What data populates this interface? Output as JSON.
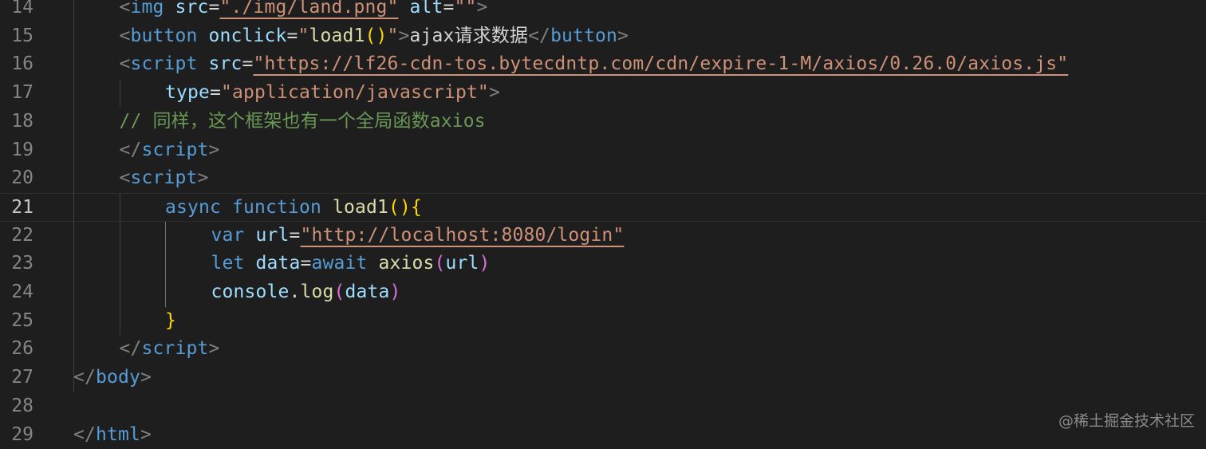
{
  "editor": {
    "lines": [
      {
        "number": "14",
        "indent": 2,
        "tokens": [
          {
            "t": "<",
            "c": "punc"
          },
          {
            "t": "img",
            "c": "tag"
          },
          {
            "t": " ",
            "c": "text"
          },
          {
            "t": "src",
            "c": "attr"
          },
          {
            "t": "=",
            "c": "text"
          },
          {
            "t": "\"./img/land.png\"",
            "c": "str"
          },
          {
            "t": " ",
            "c": "text"
          },
          {
            "t": "alt",
            "c": "attr"
          },
          {
            "t": "=",
            "c": "text"
          },
          {
            "t": "\"\"",
            "c": "str-plain"
          },
          {
            "t": ">",
            "c": "punc"
          }
        ]
      },
      {
        "number": "15",
        "indent": 2,
        "tokens": [
          {
            "t": "<",
            "c": "punc"
          },
          {
            "t": "button",
            "c": "tag"
          },
          {
            "t": " ",
            "c": "text"
          },
          {
            "t": "onclick",
            "c": "attr"
          },
          {
            "t": "=",
            "c": "text"
          },
          {
            "t": "\"",
            "c": "str-plain"
          },
          {
            "t": "load1",
            "c": "fn"
          },
          {
            "t": "()",
            "c": "brace1"
          },
          {
            "t": "\"",
            "c": "str-plain"
          },
          {
            "t": ">",
            "c": "punc"
          },
          {
            "t": "ajax请求数据",
            "c": "text"
          },
          {
            "t": "</",
            "c": "punc"
          },
          {
            "t": "button",
            "c": "tag"
          },
          {
            "t": ">",
            "c": "punc"
          }
        ]
      },
      {
        "number": "16",
        "indent": 2,
        "tokens": [
          {
            "t": "<",
            "c": "punc"
          },
          {
            "t": "script",
            "c": "tag"
          },
          {
            "t": " ",
            "c": "text"
          },
          {
            "t": "src",
            "c": "attr"
          },
          {
            "t": "=",
            "c": "text"
          },
          {
            "t": "\"https://lf26-cdn-tos.bytecdntp.com/cdn/expire-1-M/axios/0.26.0/axios.js\"",
            "c": "str"
          }
        ]
      },
      {
        "number": "17",
        "indent": 3,
        "tokens": [
          {
            "t": "type",
            "c": "attr"
          },
          {
            "t": "=",
            "c": "text"
          },
          {
            "t": "\"application/javascript\"",
            "c": "str-plain"
          },
          {
            "t": ">",
            "c": "punc"
          }
        ]
      },
      {
        "number": "18",
        "indent": 2,
        "tokens": [
          {
            "t": "// 同样，这个框架也有一个全局函数axios",
            "c": "comment"
          }
        ]
      },
      {
        "number": "19",
        "indent": 2,
        "tokens": [
          {
            "t": "</",
            "c": "punc"
          },
          {
            "t": "script",
            "c": "tag"
          },
          {
            "t": ">",
            "c": "punc"
          }
        ]
      },
      {
        "number": "20",
        "indent": 2,
        "tokens": [
          {
            "t": "<",
            "c": "punc"
          },
          {
            "t": "script",
            "c": "tag"
          },
          {
            "t": ">",
            "c": "punc"
          }
        ]
      },
      {
        "number": "21",
        "indent": 3,
        "current": true,
        "tokens": [
          {
            "t": "async",
            "c": "kw"
          },
          {
            "t": " ",
            "c": "text"
          },
          {
            "t": "function",
            "c": "kw"
          },
          {
            "t": " ",
            "c": "text"
          },
          {
            "t": "load1",
            "c": "fn"
          },
          {
            "t": "()",
            "c": "brace1"
          },
          {
            "t": "{",
            "c": "brace1"
          }
        ]
      },
      {
        "number": "22",
        "indent": 4,
        "tokens": [
          {
            "t": "var",
            "c": "kw"
          },
          {
            "t": " ",
            "c": "text"
          },
          {
            "t": "url",
            "c": "var"
          },
          {
            "t": "=",
            "c": "text"
          },
          {
            "t": "\"http://localhost:8080/login\"",
            "c": "str"
          }
        ]
      },
      {
        "number": "23",
        "indent": 4,
        "tokens": [
          {
            "t": "let",
            "c": "kw"
          },
          {
            "t": " ",
            "c": "text"
          },
          {
            "t": "data",
            "c": "var"
          },
          {
            "t": "=",
            "c": "text"
          },
          {
            "t": "await",
            "c": "kw"
          },
          {
            "t": " ",
            "c": "text"
          },
          {
            "t": "axios",
            "c": "fn"
          },
          {
            "t": "(",
            "c": "brace2"
          },
          {
            "t": "url",
            "c": "var"
          },
          {
            "t": ")",
            "c": "brace2"
          }
        ]
      },
      {
        "number": "24",
        "indent": 4,
        "tokens": [
          {
            "t": "console",
            "c": "var"
          },
          {
            "t": ".",
            "c": "text"
          },
          {
            "t": "log",
            "c": "fn"
          },
          {
            "t": "(",
            "c": "brace2"
          },
          {
            "t": "data",
            "c": "var"
          },
          {
            "t": ")",
            "c": "brace2"
          }
        ]
      },
      {
        "number": "25",
        "indent": 3,
        "tokens": [
          {
            "t": "}",
            "c": "brace1"
          }
        ]
      },
      {
        "number": "26",
        "indent": 2,
        "tokens": [
          {
            "t": "</",
            "c": "punc"
          },
          {
            "t": "script",
            "c": "tag"
          },
          {
            "t": ">",
            "c": "punc"
          }
        ]
      },
      {
        "number": "27",
        "indent": 1,
        "tokens": [
          {
            "t": "</",
            "c": "punc"
          },
          {
            "t": "body",
            "c": "tag"
          },
          {
            "t": ">",
            "c": "punc"
          }
        ]
      },
      {
        "number": "28",
        "indent": 0,
        "tokens": []
      },
      {
        "number": "29",
        "indent": 1,
        "tokens": [
          {
            "t": "</",
            "c": "punc"
          },
          {
            "t": "html",
            "c": "tag"
          },
          {
            "t": ">",
            "c": "punc"
          }
        ]
      }
    ]
  },
  "watermark": {
    "text": "@稀土掘金技术社区"
  },
  "colors": {
    "background": "#1e1e1e",
    "tag": "#569cd6",
    "attribute": "#9cdcfe",
    "string": "#ce9178",
    "function": "#dcdcaa",
    "comment": "#6a9955",
    "brace_gold": "#ffd700",
    "brace_purple": "#da70d6"
  }
}
